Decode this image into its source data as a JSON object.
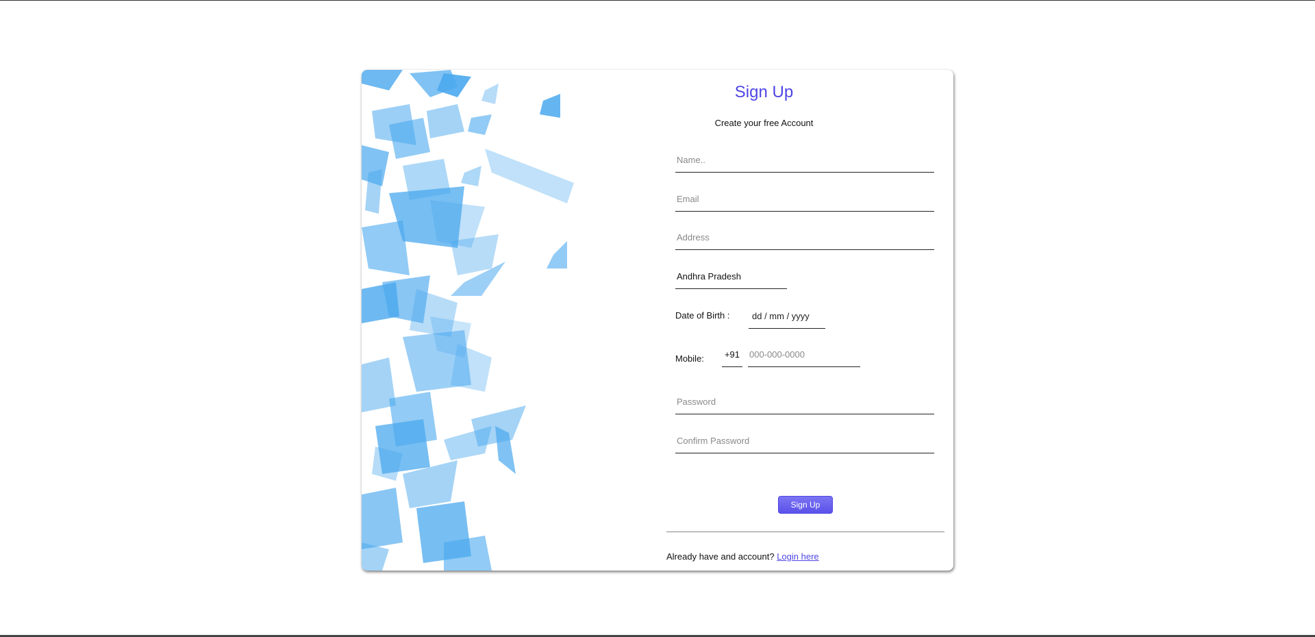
{
  "form": {
    "title": "Sign Up",
    "subtitle": "Create your free Account",
    "name_placeholder": "Name..",
    "email_placeholder": "Email",
    "address_placeholder": "Address",
    "state_value": "Andhra Pradesh",
    "dob_label": "Date of Birth :",
    "dob_value": "dd / mm / yyyy",
    "mobile_label": "Mobile:",
    "country_code": "+91",
    "mobile_placeholder": "000-000-0000",
    "password_placeholder": "Password",
    "confirm_password_placeholder": "Confirm Password",
    "submit_label": "Sign Up",
    "footer_text": "Already have and account?",
    "login_link": "Login here"
  },
  "colors": {
    "accent": "#4f46e5",
    "art_blue": "#4aa8ee"
  }
}
